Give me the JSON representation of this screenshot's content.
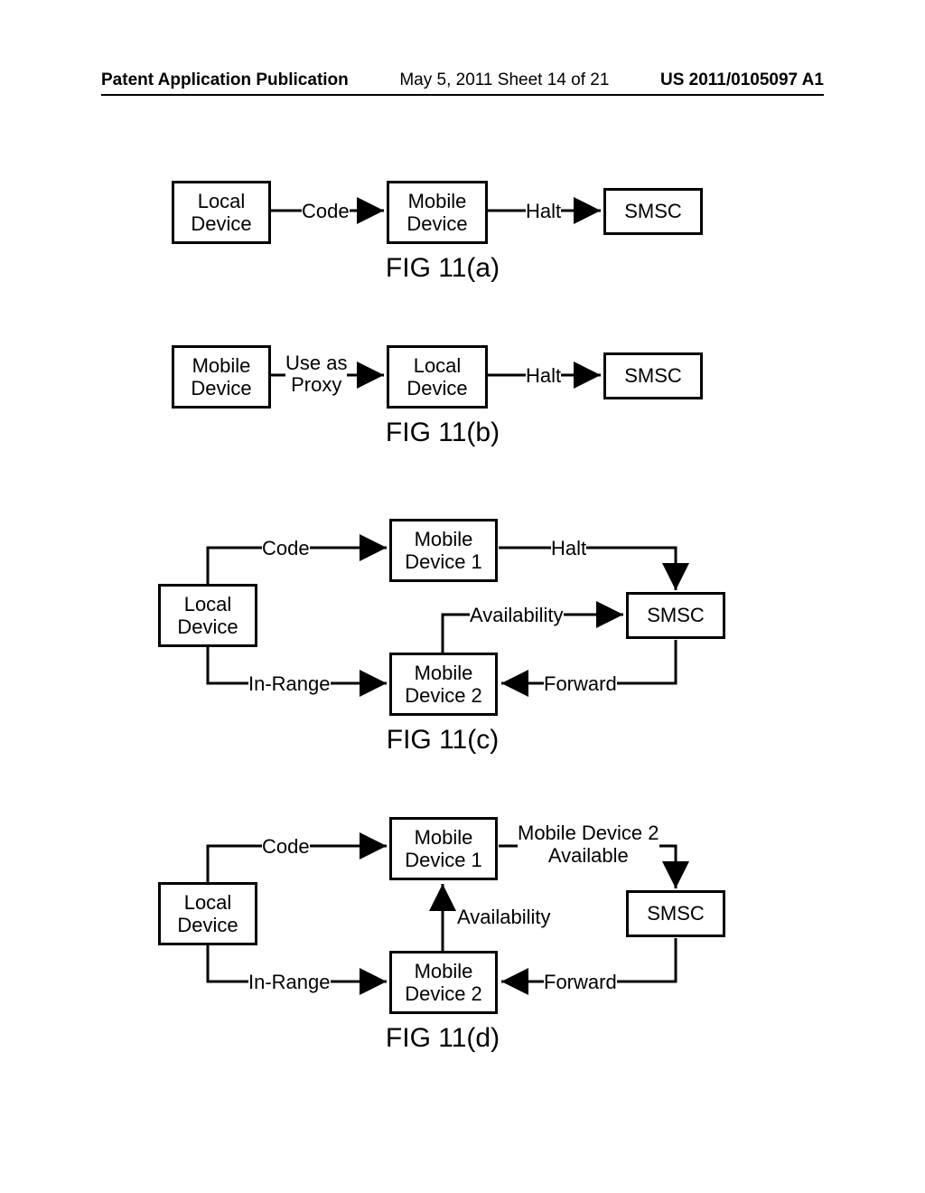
{
  "header": {
    "left": "Patent Application Publication",
    "mid": "May 5, 2011  Sheet 14 of 21",
    "right": "US 2011/0105097 A1"
  },
  "fig_a": {
    "box_local": "Local\nDevice",
    "box_mobile": "Mobile\nDevice",
    "box_smsc": "SMSC",
    "lbl_code": "Code",
    "lbl_halt": "Halt",
    "caption": "FIG 11(a)"
  },
  "fig_b": {
    "box_mobile": "Mobile\nDevice",
    "box_local": "Local\nDevice",
    "box_smsc": "SMSC",
    "lbl_proxy": "Use as\nProxy",
    "lbl_halt": "Halt",
    "caption": "FIG 11(b)"
  },
  "fig_c": {
    "box_local": "Local\nDevice",
    "box_md1": "Mobile\nDevice 1",
    "box_md2": "Mobile\nDevice 2",
    "box_smsc": "SMSC",
    "lbl_code": "Code",
    "lbl_inrange": "In-Range",
    "lbl_halt": "Halt",
    "lbl_avail": "Availability",
    "lbl_forward": "Forward",
    "caption": "FIG 11(c)"
  },
  "fig_d": {
    "box_local": "Local\nDevice",
    "box_md1": "Mobile\nDevice 1",
    "box_md2": "Mobile\nDevice 2",
    "box_smsc": "SMSC",
    "lbl_code": "Code",
    "lbl_inrange": "In-Range",
    "lbl_md2avail": "Mobile Device 2\nAvailable",
    "lbl_avail": "Availability",
    "lbl_forward": "Forward",
    "caption": "FIG 11(d)"
  }
}
